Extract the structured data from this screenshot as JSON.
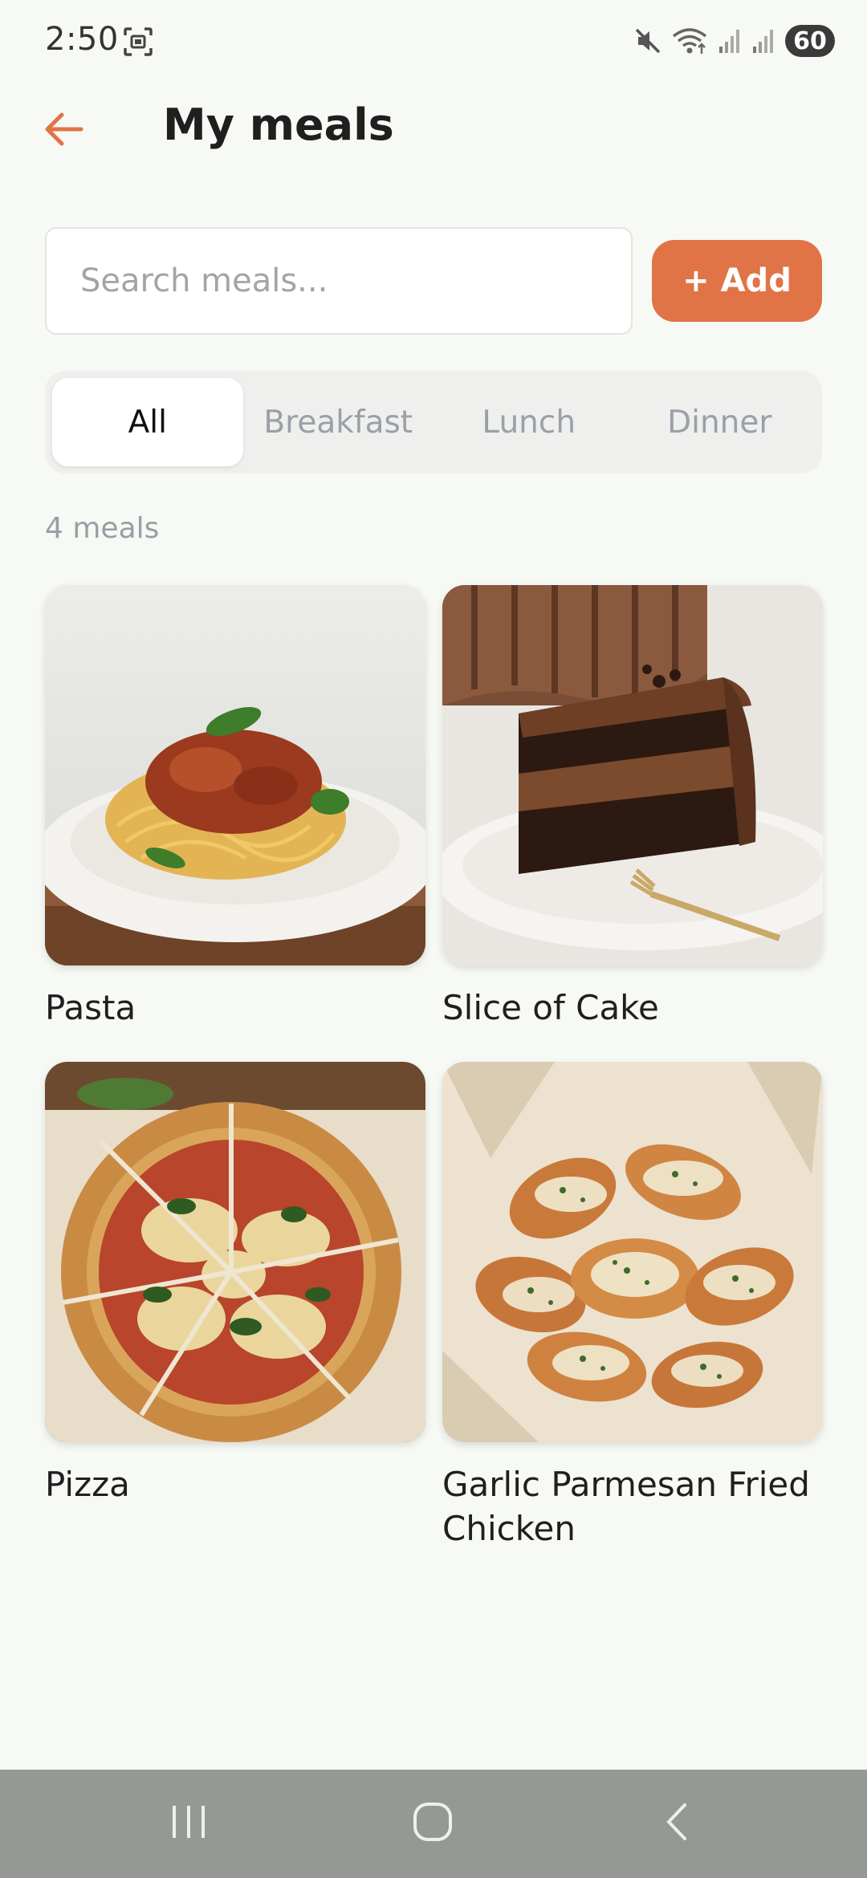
{
  "status_bar": {
    "time": "2:50",
    "battery": "60",
    "icons": [
      "screenshot-icon",
      "mute-icon",
      "wifi-icon",
      "signal-icon",
      "signal-icon",
      "battery-icon"
    ]
  },
  "header": {
    "title": "My meals",
    "back_icon": "arrow-left-icon"
  },
  "search": {
    "placeholder": "Search meals...",
    "value": ""
  },
  "add_button": {
    "label": "+ Add"
  },
  "tabs": [
    {
      "label": "All",
      "active": true
    },
    {
      "label": "Breakfast",
      "active": false
    },
    {
      "label": "Lunch",
      "active": false
    },
    {
      "label": "Dinner",
      "active": false
    }
  ],
  "meal_count": "4 meals",
  "meals": [
    {
      "name": "Pasta",
      "image": "pasta-photo"
    },
    {
      "name": "Slice of Cake",
      "image": "chocolate-cake-photo"
    },
    {
      "name": "Pizza",
      "image": "pizza-photo"
    },
    {
      "name": "Garlic Parmesan Fried Chicken",
      "image": "fried-chicken-wings-photo"
    }
  ],
  "nav_bar": {
    "buttons": [
      "recent-apps-icon",
      "home-icon",
      "back-icon"
    ]
  },
  "colors": {
    "accent": "#e07446",
    "background": "#f7f9f5",
    "tab_background": "#efefed",
    "inactive_tab_text": "#9aa0a8",
    "nav_bar": "#959995"
  }
}
